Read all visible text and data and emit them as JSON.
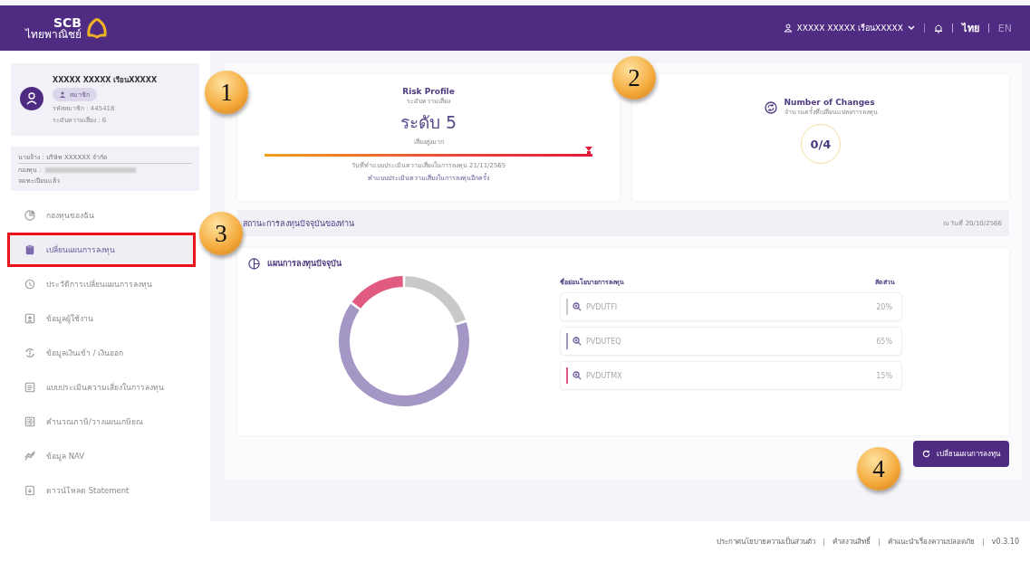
{
  "header": {
    "logo": {
      "brand": "SCB",
      "name": "ไทยพาณิชย์"
    },
    "user": "XXXXX XXXXX เรือนXXXXX",
    "languages": [
      {
        "label": "ไทย",
        "selected": true
      },
      {
        "label": "EN",
        "selected": false
      }
    ]
  },
  "profile": {
    "name": "XXXXX XXXXX เรือนXXXXX",
    "badge": "สมาชิก",
    "member_id": "รหัสสมาชิก : 445418",
    "risk_level": "ระดับความเสี่ยง : 6"
  },
  "employer": {
    "company": "นายจ้าง : บริษัท XXXXXX จำกัด",
    "fund_label": "กองทุน :",
    "status": "จดทะเบียนแล้ว"
  },
  "menu": [
    {
      "label": "กองทุนของฉัน",
      "selected": false,
      "highlighted": false
    },
    {
      "label": "เปลี่ยนแผนการลงทุน",
      "selected": true,
      "highlighted": true
    },
    {
      "label": "ประวัติการเปลี่ยนแผนการลงทุน",
      "selected": false,
      "highlighted": false
    },
    {
      "label": "ข้อมูลผู้ใช้งาน",
      "selected": false,
      "highlighted": false
    },
    {
      "label": "ข้อมูลเงินเข้า / เงินออก",
      "selected": false,
      "highlighted": false
    },
    {
      "label": "แบบประเมินความเสี่ยงในการลงทุน",
      "selected": false,
      "highlighted": false
    },
    {
      "label": "คำนวณภาษี/วางแผนเกษียณ",
      "selected": false,
      "highlighted": false
    },
    {
      "label": "ข้อมูล NAV",
      "selected": false,
      "highlighted": false
    },
    {
      "label": "ดาวน์โหลด Statement",
      "selected": false,
      "highlighted": false
    }
  ],
  "risk_profile": {
    "title": "Risk Profile",
    "subtitle": "ระดับความเสี่ยง",
    "level_text": "ระดับ 5",
    "description": "เสี่ยงสูงมาก",
    "level": 0.99,
    "date_text": "วันที่ทำแบบประเมินความเสี่ยงในการลงทุน 21/11/2565",
    "link": "ทำแบบประเมินความเสี่ยงในการลงทุนอีกครั้ง"
  },
  "changes": {
    "title": "Number of Changes",
    "subtitle": "จำนวนครั้งที่เปลี่ยนแปลงการลงทุน",
    "count": "0/4"
  },
  "status": {
    "title": "สถานะการลงทุนปัจจุบันของท่าน",
    "date": "ณ วันที่ 20/10/2566"
  },
  "plan": {
    "title": "แผนการลงทุนปัจจุบัน",
    "columns": [
      "ชื่อย่อนโยบายการลงทุน",
      "สัดส่วน"
    ],
    "funds": [
      {
        "name": "PVDUTFI",
        "share": "20%",
        "color": "#c9c9c9"
      },
      {
        "name": "PVDUTEQ",
        "share": "65%",
        "color": "#a497c6"
      },
      {
        "name": "PVDUTMX",
        "share": "15%",
        "color": "#e15a80"
      }
    ],
    "chart_data": {
      "type": "donut",
      "values": [
        20,
        65,
        15
      ]
    }
  },
  "change_button": "เปลี่ยนแผนการลงทุน",
  "footer": {
    "links": [
      "ประกาศนโยบายความเป็นส่วนตัว",
      "คำสงวนสิทธิ์",
      "คำแนะนำเรื่องความปลอดภัย"
    ],
    "version": "v0.3.10"
  },
  "annotations": [
    {
      "number": "1"
    },
    {
      "number": "2"
    },
    {
      "number": "3"
    },
    {
      "number": "4"
    }
  ]
}
